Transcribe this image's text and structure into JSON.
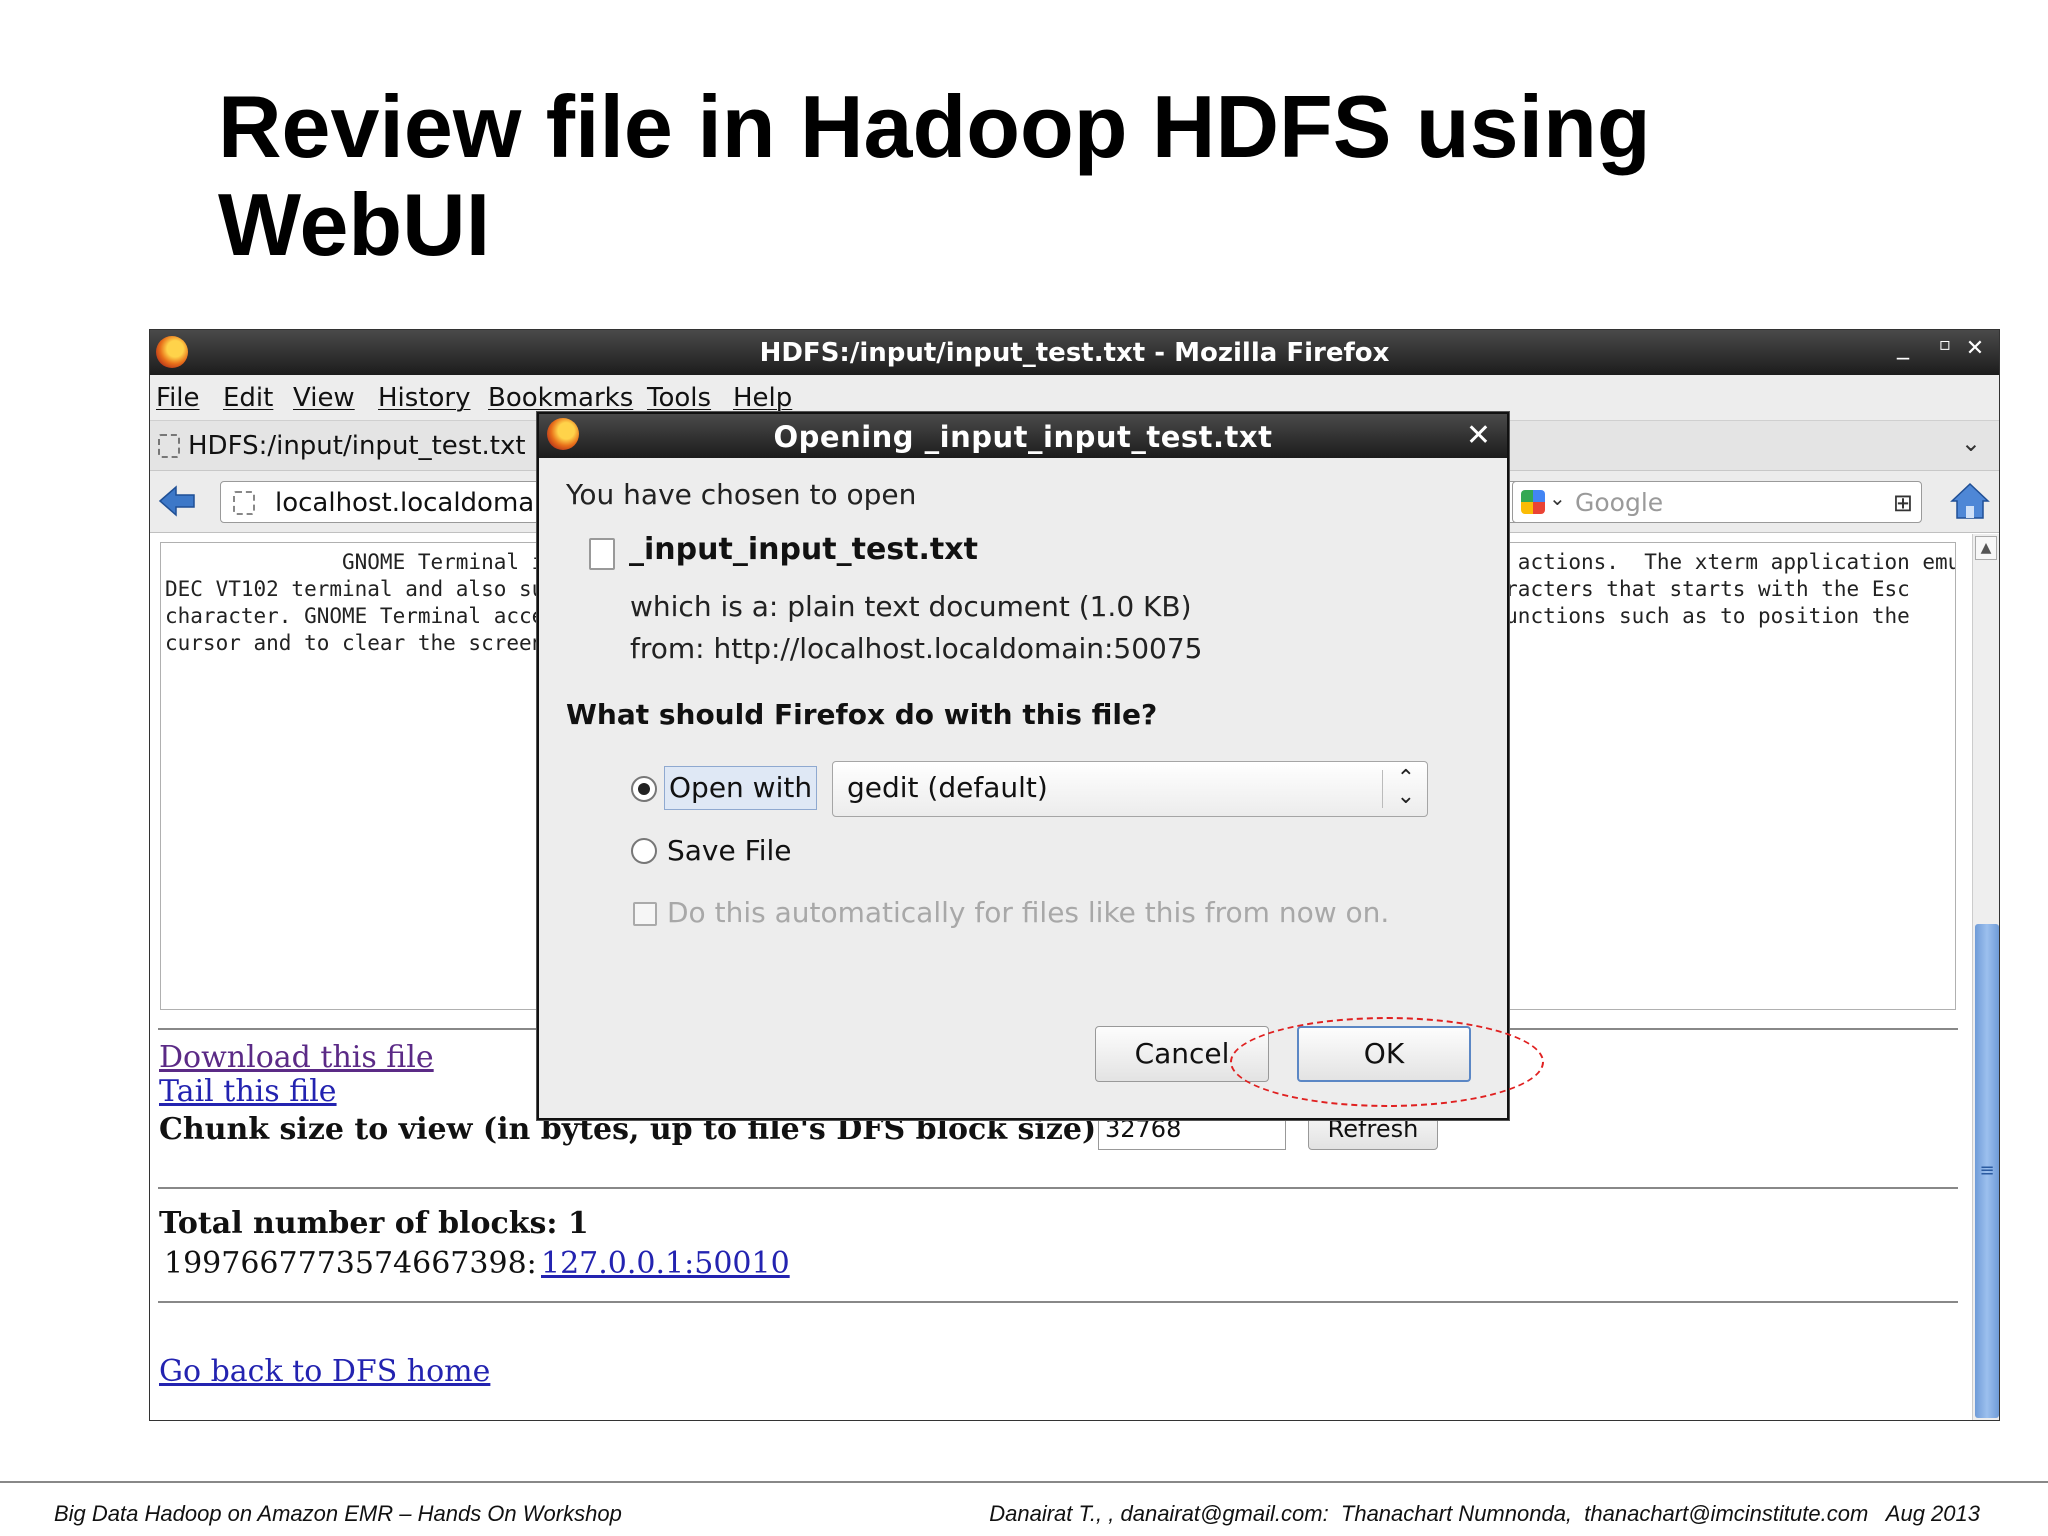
{
  "slide": {
    "title": "Review file in Hadoop HDFS using WebUI",
    "footer_left": "Big Data Hadoop on Amazon EMR – Hands On Workshop",
    "footer_right": "Danairat T., , danairat@gmail.com:  Thanachart Numnonda,  thanachart@imcinstitute.com   Aug 2013"
  },
  "window": {
    "title": "HDFS:/input/input_test.txt - Mozilla Firefox",
    "minimize": "_",
    "maximize": "▫",
    "close": "✕"
  },
  "menu": [
    "File",
    "Edit",
    "View",
    "History",
    "Bookmarks",
    "Tools",
    "Help"
  ],
  "tab": {
    "label": "HDFS:/input/input_test.txt",
    "chevron": "⌄"
  },
  "navbar": {
    "url": "localhost.localdomain",
    "search_placeholder": "Google"
  },
  "page": {
    "file_text": "              GNOME Terminal is a terminal emulation application that you can use to perform the following actions.  The xterm application emulates the\nDEC VT102 terminal and also supports the DEC VT220 escape sequences. An escape sequence is a series of characters that starts with the Esc\ncharacter. GNOME Terminal accepts all of the escape sequences that the VT102 and VT220 terminals use for functions such as to position the\ncursor and to clear the screen.",
    "download_link": "Download this file",
    "tail_link": "Tail this file",
    "chunk_label": "Chunk size to view (in bytes, up to file's DFS block size):",
    "chunk_value": "32768",
    "refresh_label": "Refresh",
    "blocks_label": "Total number of blocks: 1",
    "block_id": "1997667773574667398:",
    "block_link": "127.0.0.1:50010",
    "back_link": "Go back to DFS home"
  },
  "dialog": {
    "title": "Opening _input_input_test.txt",
    "close": "✕",
    "chosen": "You have chosen to open",
    "file_name": "_input_input_test.txt",
    "which_is": "which is a:  plain text document (1.0 KB)",
    "from": "from:  http://localhost.localdomain:50075",
    "question": "What should Firefox do with this file?",
    "open_with_label": "Open with",
    "app_selected": "gedit (default)",
    "save_file_label": "Save File",
    "auto_label": "Do this automatically for files like this from now on.",
    "cancel_label": "Cancel",
    "ok_label": "OK",
    "selected_option": "open_with"
  },
  "colors": {
    "link": "#2323b0",
    "visited_link": "#5b2a86",
    "highlight": "#e02020",
    "scroll_thumb": "#6f9bd7"
  }
}
